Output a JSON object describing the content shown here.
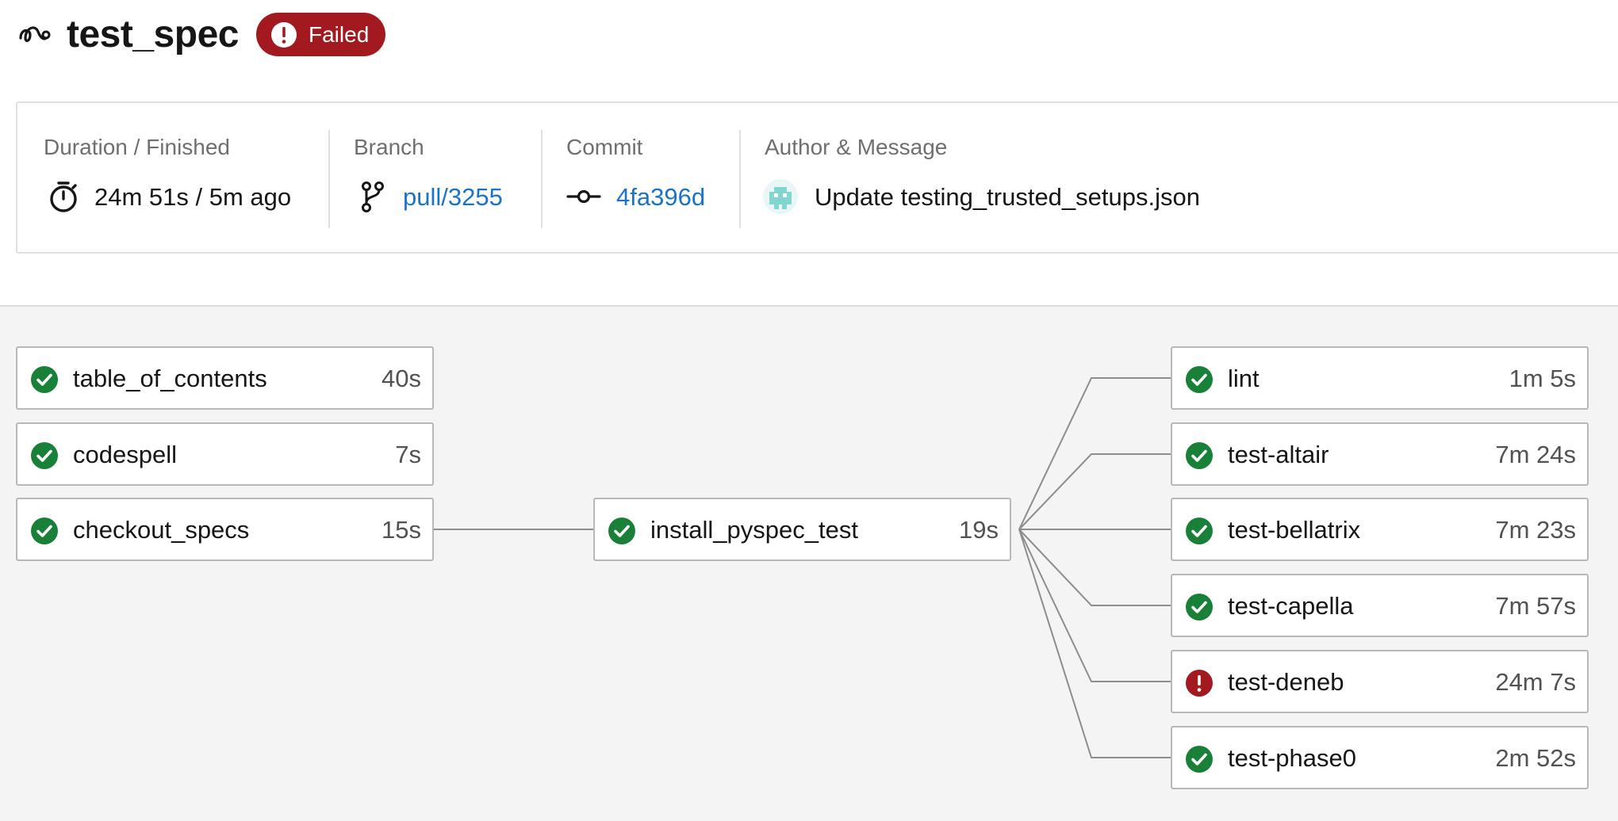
{
  "workflow": {
    "icon": "workflow-icon",
    "name": "test_spec",
    "status": "Failed",
    "status_icon": "error-icon",
    "status_color": "#a2191f"
  },
  "info": {
    "duration": {
      "label": "Duration / Finished",
      "value": "24m 51s / 5m ago",
      "icon": "timer-icon"
    },
    "branch": {
      "label": "Branch",
      "value": "pull/3255",
      "icon": "branch-icon"
    },
    "commit": {
      "label": "Commit",
      "value": "4fa396d",
      "icon": "commit-icon"
    },
    "author": {
      "label": "Author & Message",
      "message": "Update testing_trusted_setups.json",
      "icon": "avatar"
    }
  },
  "colors": {
    "success": "#198038",
    "failed": "#a2191f",
    "link": "#1a73c8"
  },
  "jobs": {
    "table_of_contents": {
      "name": "table_of_contents",
      "duration": "40s",
      "status": "success"
    },
    "codespell": {
      "name": "codespell",
      "duration": "7s",
      "status": "success"
    },
    "checkout_specs": {
      "name": "checkout_specs",
      "duration": "15s",
      "status": "success"
    },
    "install_pyspec_test": {
      "name": "install_pyspec_test",
      "duration": "19s",
      "status": "success"
    },
    "lint": {
      "name": "lint",
      "duration": "1m 5s",
      "status": "success"
    },
    "test_altair": {
      "name": "test-altair",
      "duration": "7m 24s",
      "status": "success"
    },
    "test_bellatrix": {
      "name": "test-bellatrix",
      "duration": "7m 23s",
      "status": "success"
    },
    "test_capella": {
      "name": "test-capella",
      "duration": "7m 57s",
      "status": "success"
    },
    "test_deneb": {
      "name": "test-deneb",
      "duration": "24m 7s",
      "status": "failed"
    },
    "test_phase0": {
      "name": "test-phase0",
      "duration": "2m 52s",
      "status": "success"
    }
  }
}
